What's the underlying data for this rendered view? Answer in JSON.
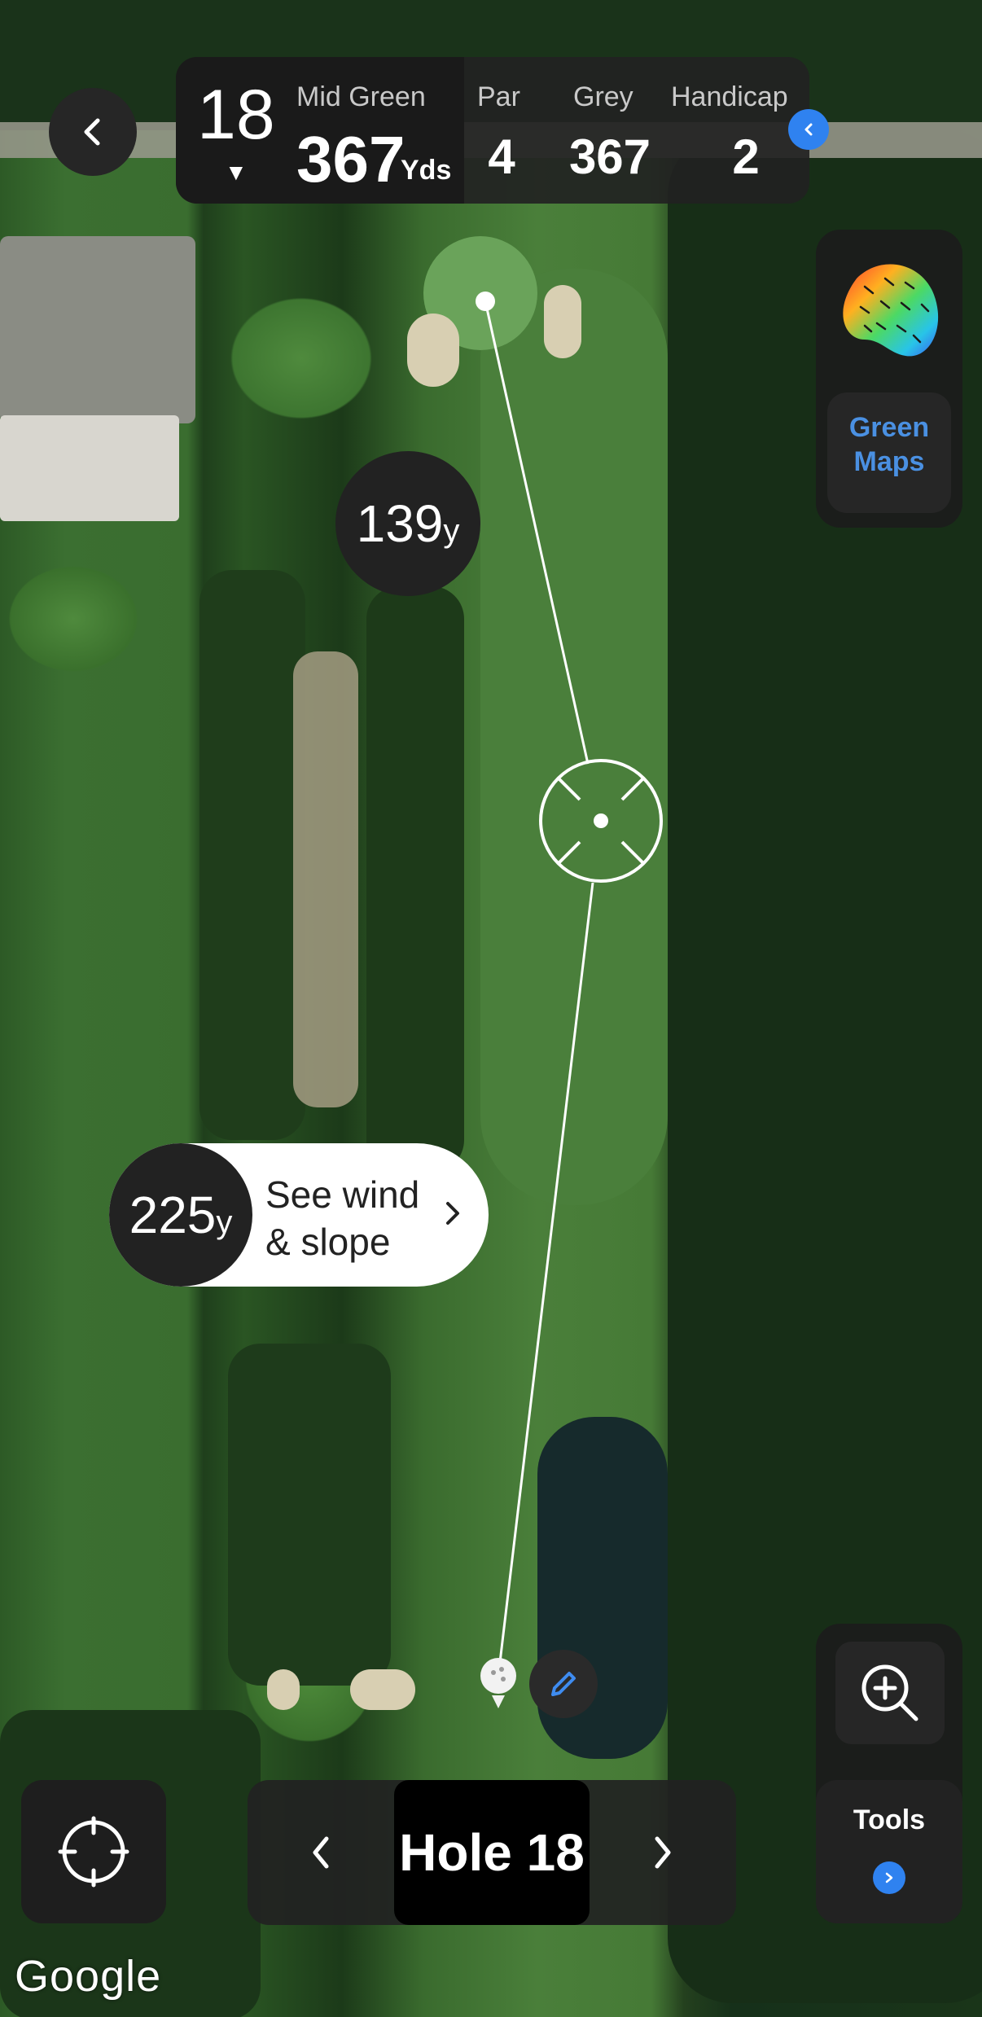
{
  "header": {
    "hole_number": "18",
    "target_label": "Mid Green",
    "target_distance": "367",
    "target_unit": "Yds",
    "par_label": "Par",
    "par_value": "4",
    "tee_label": "Grey",
    "tee_value": "367",
    "handicap_label": "Handicap",
    "handicap_value": "2"
  },
  "green_maps": {
    "label_line1": "Green",
    "label_line2": "Maps"
  },
  "overlays": {
    "front_distance": "139",
    "front_unit": "y",
    "shot_distance": "225",
    "shot_unit": "y",
    "wind_line1": "See wind",
    "wind_line2": "& slope"
  },
  "navigation": {
    "current_hole": "Hole 18"
  },
  "tools": {
    "label": "Tools"
  },
  "map_attribution": "Google",
  "colors": {
    "accent": "#2f82f0",
    "green_maps_text": "#4a90e2",
    "panel": "#222222"
  }
}
